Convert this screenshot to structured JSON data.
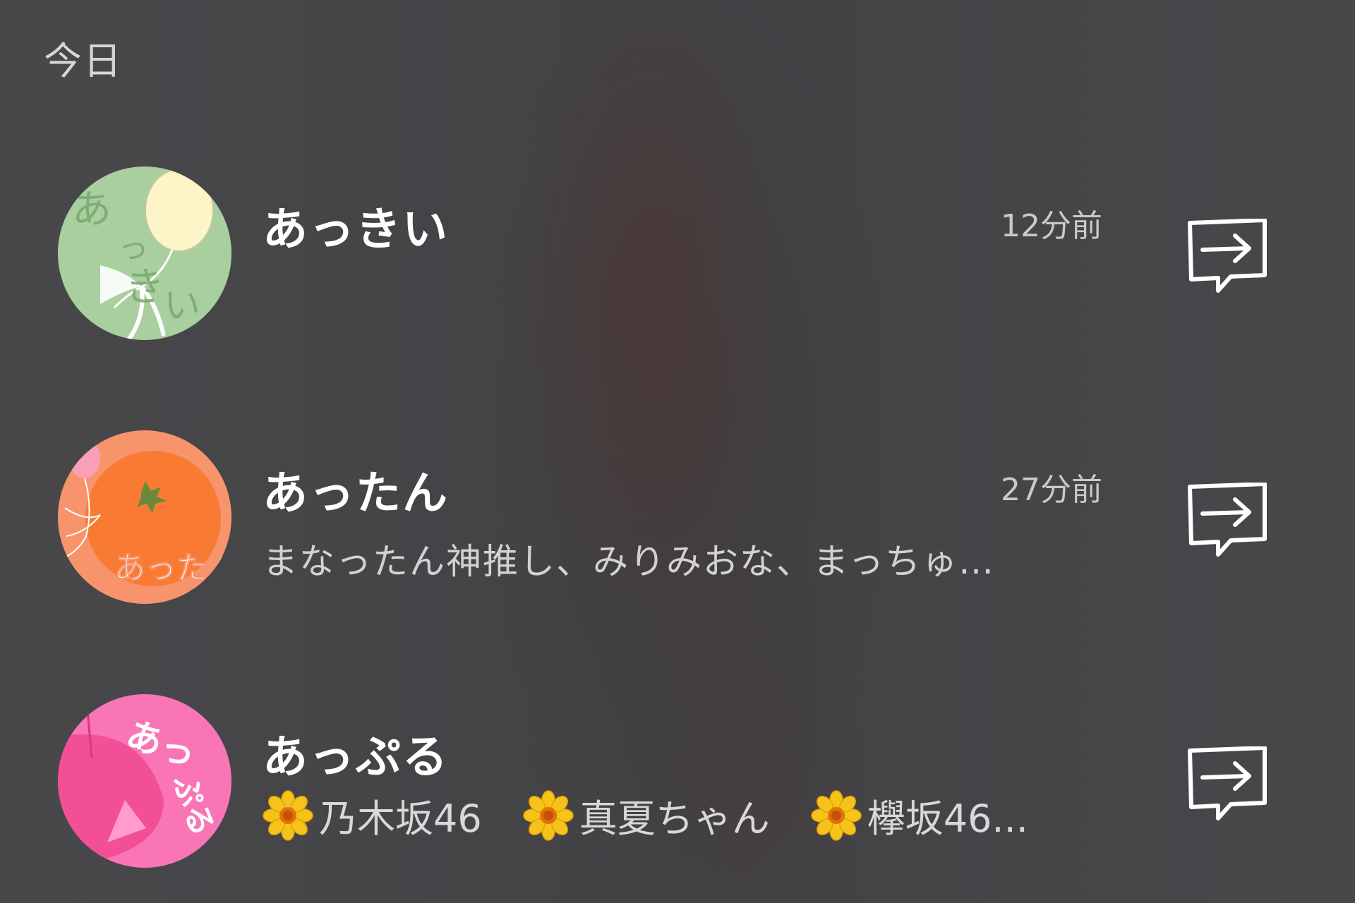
{
  "section": {
    "header": "今日"
  },
  "items": [
    {
      "name": "あっきい",
      "time": "12分前",
      "subtitle": "",
      "avatar": {
        "bg": "#a9cf9f",
        "text": "あっきい",
        "accent": "#fbf5c8"
      }
    },
    {
      "name": "あったん",
      "time": "27分前",
      "subtitle": "まなったん神推し、みりみおな、まっちゅ…",
      "avatar": {
        "bg": "#f7946c",
        "text": "あったん",
        "accent": "#f97b33"
      }
    },
    {
      "name": "あっぷる",
      "time": "",
      "subtitle": "",
      "tags": [
        {
          "icon": "sunflower-icon",
          "label": "乃木坂46"
        },
        {
          "icon": "sunflower-icon",
          "label": "真夏ちゃん"
        },
        {
          "icon": "sunflower-icon",
          "label": "欅坂46..."
        }
      ],
      "avatar": {
        "bg": "#f975b5",
        "text": "あっぷる",
        "accent": "#f24f96"
      }
    }
  ],
  "icons": {
    "share": "share-reply-icon"
  },
  "colors": {
    "background": "#454548",
    "name_text": "#ffffff",
    "secondary_text": "#c9c9cb"
  }
}
